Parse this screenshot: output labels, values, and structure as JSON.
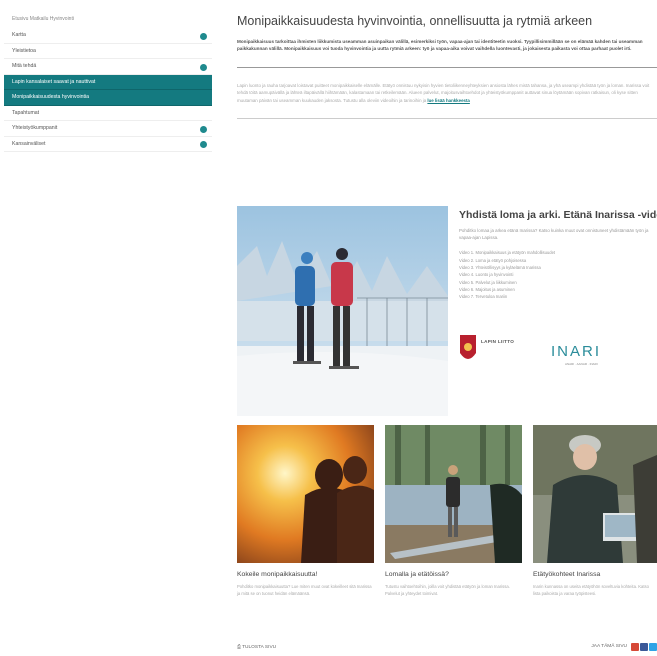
{
  "sidebar": {
    "top_label": "Etusivu  Matkailu  Hyvinvointi",
    "items": [
      {
        "label": "Kartta",
        "has_dot": true,
        "active": false
      },
      {
        "label": "Yleistietoa",
        "has_dot": false,
        "active": false
      },
      {
        "label": "Mitä tehdä",
        "has_dot": true,
        "active": false
      },
      {
        "label": "Lapin kansalaiset saavat ja nauttivat",
        "has_dot": false,
        "active": true
      },
      {
        "label": "Monipaikkaisuudesta hyvinvointia",
        "has_dot": false,
        "active": true
      },
      {
        "label": "Tapahtumat",
        "has_dot": false,
        "active": false
      },
      {
        "label": "Yhteistyökumppanit",
        "has_dot": true,
        "active": false
      },
      {
        "label": "Kansainväliset",
        "has_dot": true,
        "active": false
      }
    ]
  },
  "main": {
    "title": "Monipaikkaisuudesta hyvinvointia, onnellisuutta ja rytmiä arkeen",
    "intro": "Monipaikkaisuus tarkoittaa ihmisten liikkumista useamman asuinpaikan välillä, esimerkiksi työn, vapaa-ajan tai identiteetin vuoksi. Tyypillisimmillään se on elämää kahden tai useamman paikkakunnan välillä. Monipaikkaisuus voi tuoda hyvinvointia ja uutta rytmiä arkeen: työ ja vapaa-aika voivat vaihdella luontevasti, ja jokaisesta paikasta voi ottaa parhaat puolet irti.",
    "body": "Lapin luonto ja rauha tarjoavat loistavat puitteet monipaikkaiselle elämälle. Etätyö onnistuu nykyisin hyvien tietoliikenneyhteyksien ansiosta lähes mistä tahansa, ja yhä useampi yhdistää työn ja loman. Inarissa voit tehdä töitä aamupäivällä ja lähteä iltapäivällä hiihtämään, kalastamaan tai retkeilemään. Alueen palvelut, majoitusvaihtoehdot ja yhteistyökumppanit auttavat sinua löytämään sopivan ratkaisun, oli kyse sitten muutaman päivän tai useamman kuukauden jaksosta. Tutustu alla oleviin videoihin ja tarinoihin ja",
    "body_link": "lue lisää hankkeesta"
  },
  "feature": {
    "title": "Yhdistä loma ja arki. Etänä Inarissa -videot",
    "description": "Pohditko lomaa ja arkea etänä Inarissa? Katso kuinka muut ovat onnistuneet yhdistämään työn ja vapaa-ajan Lapissa.",
    "videos": [
      "Video 1. Monipaikkaisuus ja etätyön mahdollisuudet",
      "Video 2. Loma ja etätyö pohjoisessa",
      "Video 3. Yhteisöllisyys ja kyläelämä Inarissa",
      "Video 4. Luonto ja hyvinvointi",
      "Video 5. Palvelut ja liikkuminen",
      "Video 6. Majoitus ja asuminen",
      "Video 7. Tervetuloa Inariin"
    ],
    "logo1": "LAPIN LIITTO",
    "logo2": "INARI",
    "logo2_sub": "ANARI · AANAR · INARI"
  },
  "cards": [
    {
      "title": "Kokeile monipaikkaisuutta!",
      "desc": "Pohditko monipaikkaisuutta? Lue miten muut ovat kokeilleet sitä Inarissa ja mitä se on tuonut heidän elämäänsä."
    },
    {
      "title": "Lomalla ja etätöissä?",
      "desc": "Tutustu vaihtoehtoihin, joilla voit yhdistää etätyön ja loman Inarissa. Palvelut ja yhteydet toimivat."
    },
    {
      "title": "Etätyökohteet Inarissa",
      "desc": "Inarin kunnassa on useita etätyöhön soveltuvia kohteita. Katso lista paikoista ja varaa työpisteesi."
    }
  ],
  "footer": {
    "print": "TULOSTA SIVU",
    "share": "JAA TÄMÄ SIVU"
  },
  "colors": {
    "accent": "#147a80",
    "dot": "#1f8a8e"
  }
}
